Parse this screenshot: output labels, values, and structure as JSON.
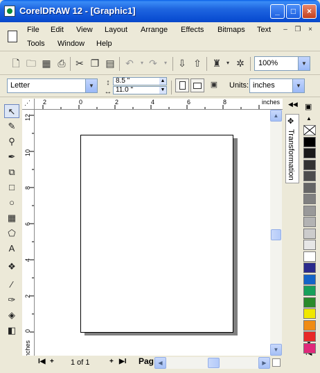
{
  "window": {
    "title": "CorelDRAW 12 - [Graphic1]",
    "minimize_glyph": "_",
    "maximize_glyph": "□",
    "close_glyph": "×"
  },
  "menubar": {
    "items": [
      {
        "label": "File"
      },
      {
        "label": "Edit"
      },
      {
        "label": "View"
      },
      {
        "label": "Layout"
      },
      {
        "label": "Arrange"
      },
      {
        "label": "Effects"
      },
      {
        "label": "Bitmaps"
      },
      {
        "label": "Text"
      },
      {
        "label": "Tools"
      },
      {
        "label": "Window"
      },
      {
        "label": "Help"
      }
    ],
    "mdi_minimize": "–",
    "mdi_restore": "❐",
    "mdi_close": "×"
  },
  "standard_toolbar": {
    "zoom_value": "100%",
    "icons": [
      "new-icon",
      "open-icon",
      "save-icon",
      "print-icon",
      "cut-icon",
      "copy-icon",
      "paste-icon",
      "undo-icon",
      "redo-icon",
      "import-icon",
      "export-icon",
      "application-launcher-icon",
      "corel-online-icon"
    ]
  },
  "property_bar": {
    "paper_type": "Letter",
    "width": "8.5 \"",
    "height": "11.0 \"",
    "units_label": "Units:",
    "units_value": "inches"
  },
  "rulers": {
    "h_labels": [
      "2",
      "0",
      "2",
      "4",
      "6",
      "8"
    ],
    "h_unit": "inches",
    "v_labels": [
      "12",
      "10",
      "8",
      "6",
      "4",
      "2",
      "0"
    ],
    "v_unit": "inches"
  },
  "page_nav": {
    "first": "I◀",
    "prev": "+",
    "count": "1 of 1",
    "next": "+",
    "last": "▶I",
    "page_tab": "Pag"
  },
  "docker": {
    "label": "Transformation"
  },
  "palette": {
    "colors": [
      "#ffffff",
      "#000000",
      "#1a1a1a",
      "#333333",
      "#4d4d4d",
      "#666666",
      "#808080",
      "#999999",
      "#b3b3b3",
      "#cccccc",
      "#e6e6e6",
      "#ffffff",
      "#2a2a8c",
      "#1464c8",
      "#17a05a",
      "#2a8a2a",
      "#f0e800",
      "#f08c14",
      "#e82828",
      "#e0287a"
    ]
  }
}
